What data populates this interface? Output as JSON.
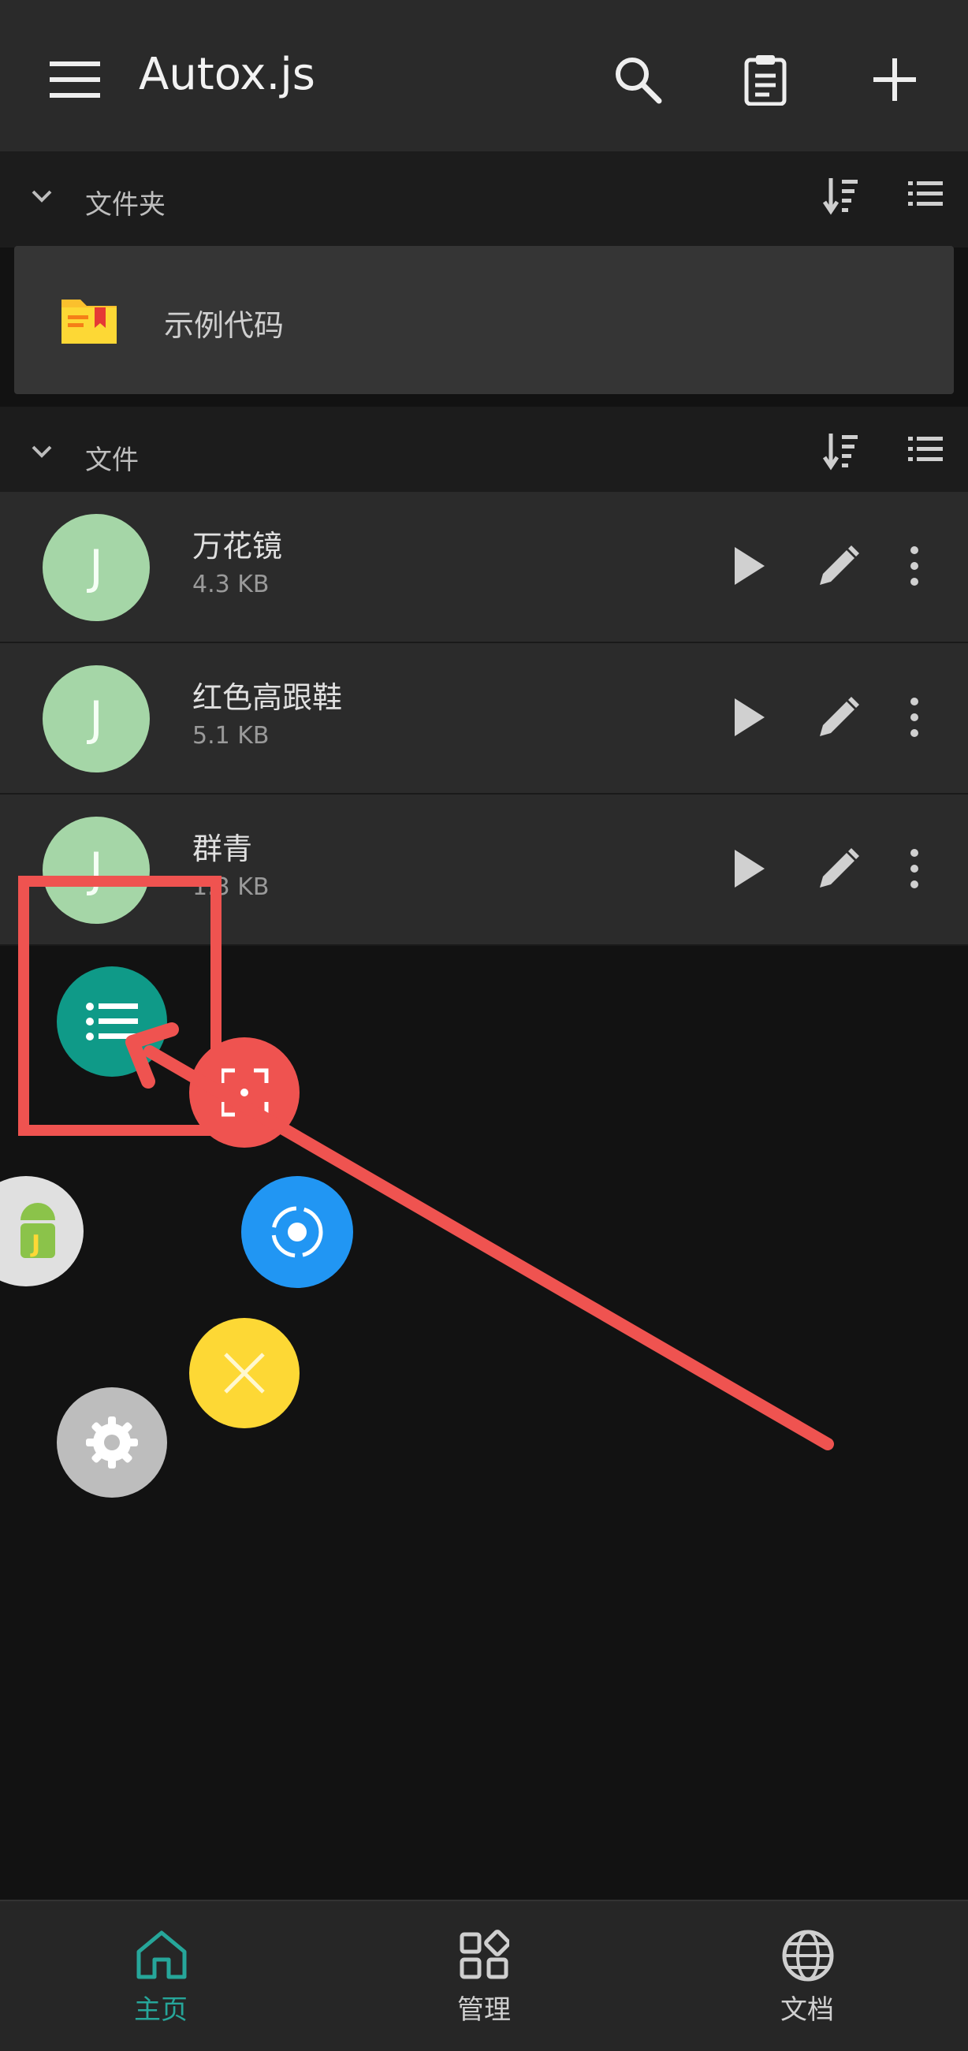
{
  "app": {
    "title": "Autox.js"
  },
  "sections": {
    "folders": {
      "label": "文件夹"
    },
    "files": {
      "label": "文件"
    }
  },
  "folders": [
    {
      "name": "示例代码"
    }
  ],
  "files": [
    {
      "name": "万花镜",
      "size": "4.3 KB",
      "avatar": "J"
    },
    {
      "name": "红色高跟鞋",
      "size": "5.1 KB",
      "avatar": "J"
    },
    {
      "name": "群青",
      "size": "1.3 KB",
      "avatar": "J"
    }
  ],
  "bottom_nav": [
    {
      "label": "主页",
      "icon": "home-icon",
      "active": true
    },
    {
      "label": "管理",
      "icon": "grid-icon",
      "active": false
    },
    {
      "label": "文档",
      "icon": "globe-icon",
      "active": false
    }
  ],
  "float_menu": [
    {
      "icon": "list-icon",
      "color": "#0f9a88"
    },
    {
      "icon": "scan-icon",
      "color": "#ef5350"
    },
    {
      "icon": "android-js-icon",
      "color": "#e0e0e0"
    },
    {
      "icon": "record-icon",
      "color": "#2196f3"
    },
    {
      "icon": "close-icon",
      "color": "#fdd835"
    },
    {
      "icon": "settings-icon",
      "color": "#bdbdbd"
    }
  ],
  "colors": {
    "accent": "#26a69a",
    "annotation": "#ef5350"
  }
}
